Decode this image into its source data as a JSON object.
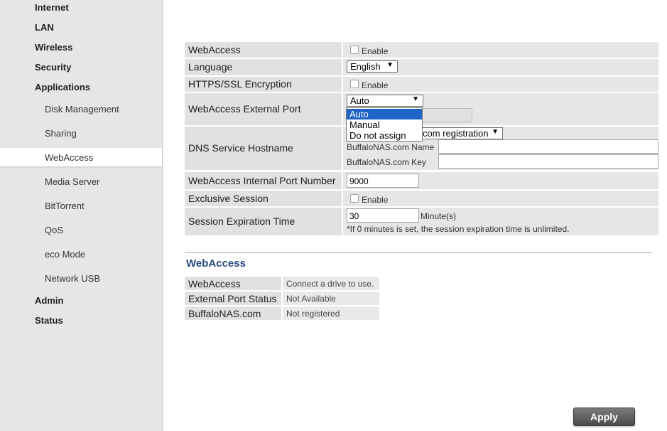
{
  "sidebar": {
    "top_items": [
      "Internet",
      "LAN",
      "Wireless",
      "Security",
      "Applications"
    ],
    "sub_items": [
      "Disk Management",
      "Sharing",
      "WebAccess",
      "Media Server",
      "BitTorrent",
      "QoS",
      "eco Mode",
      "Network USB"
    ],
    "active_sub": "WebAccess",
    "bottom_items": [
      "Admin",
      "Status"
    ]
  },
  "settings": {
    "webaccess": {
      "label": "WebAccess",
      "checkbox_label": "Enable",
      "checked": false
    },
    "language": {
      "label": "Language",
      "value": "English"
    },
    "https": {
      "label": "HTTPS/SSL Encryption",
      "checkbox_label": "Enable",
      "checked": false
    },
    "external_port": {
      "label": "WebAccess External Port",
      "selected": "Auto",
      "options": [
        "Auto",
        "Manual",
        "Do not assign"
      ]
    },
    "dns": {
      "label": "DNS Service Hostname",
      "select_value": "com registration",
      "name_label": "BuffaloNAS.com Name",
      "key_label": "BuffaloNAS.com Key"
    },
    "internal_port": {
      "label": "WebAccess Internal Port Number",
      "value": "9000"
    },
    "exclusive": {
      "label": "Exclusive Session",
      "checkbox_label": "Enable",
      "checked": false
    },
    "expiration": {
      "label": "Session Expiration Time",
      "value": "30",
      "unit": "Minute(s)",
      "note": "*If 0 minutes is set, the session expiration time is unlimited."
    }
  },
  "status": {
    "title": "WebAccess",
    "rows": [
      {
        "key": "WebAccess",
        "value": "Connect a drive to use."
      },
      {
        "key": "External Port Status",
        "value": "Not Available"
      },
      {
        "key": "BuffaloNAS.com",
        "value": "Not registered"
      }
    ]
  },
  "apply_label": "Apply"
}
